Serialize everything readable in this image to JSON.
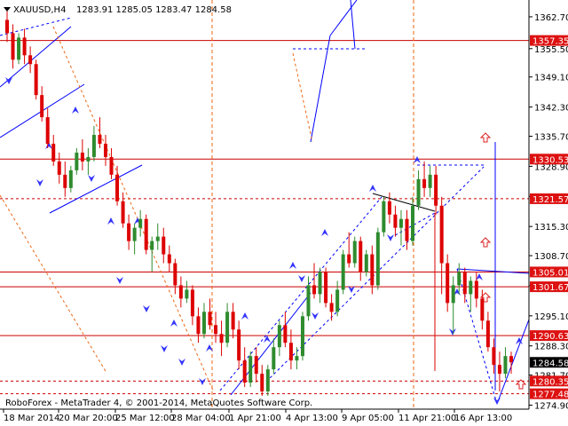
{
  "header": {
    "symbol": "XAUUSD,H4",
    "ohlc": "1283.91 1285.05 1283.47 1284.58"
  },
  "footer": {
    "copyright": "RoboForex - MetaTrader 4, © 2001-2014, MetaQuotes Software Corp."
  },
  "colors": {
    "bull": "#2e8b2e",
    "bear": "#dd0000",
    "level": "#cc0000",
    "trend": "#0000ff",
    "price_tag": "#dd1111",
    "current_tag": "#000000"
  },
  "axis": {
    "y_ticks": [
      "1362.70",
      "1355.50",
      "1349.10",
      "1342.30",
      "1335.70",
      "1328.90",
      "1322.10",
      "1315.30",
      "1308.70",
      "1301.90",
      "1295.10",
      "1288.30",
      "1281.70",
      "1274.90"
    ],
    "x_ticks": [
      "18 Mar 2014",
      "20 Mar 20:00",
      "25 Mar 12:00",
      "28 Mar 04:00",
      "1 Apr 21:00",
      "4 Apr 13:00",
      "9 Apr 05:00",
      "11 Apr 21:00",
      "16 Apr 13:00"
    ]
  },
  "chart_data": {
    "type": "candlestick",
    "symbol": "XAUUSD",
    "timeframe": "H4",
    "ylim": [
      1274.0,
      1366.5
    ],
    "current_price": "1284.58",
    "levels": [
      {
        "label": "1357.35",
        "value": 1357.35,
        "style": "solid"
      },
      {
        "label": "1330.53",
        "value": 1330.53,
        "style": "solid"
      },
      {
        "label": "1321.57",
        "value": 1321.57,
        "style": "dashed"
      },
      {
        "label": "1305.01",
        "value": 1305.01,
        "style": "solid"
      },
      {
        "label": "1301.67",
        "value": 1301.67,
        "style": "solid"
      },
      {
        "label": "1290.63",
        "value": 1290.63,
        "style": "solid"
      },
      {
        "label": "1280.35",
        "value": 1280.35,
        "style": "dashed"
      },
      {
        "label": "1277.48",
        "value": 1277.48,
        "style": "dashed"
      }
    ],
    "candles": [
      [
        1362.0,
        1364.0,
        1357.0,
        1359.0
      ],
      [
        1359.0,
        1361.0,
        1351.0,
        1353.0
      ],
      [
        1353.0,
        1359.0,
        1352.0,
        1358.0
      ],
      [
        1358.0,
        1360.0,
        1352.0,
        1354.0
      ],
      [
        1354.0,
        1356.0,
        1350.0,
        1352.0
      ],
      [
        1352.0,
        1353.0,
        1344.0,
        1345.0
      ],
      [
        1345.0,
        1347.0,
        1339.0,
        1340.0
      ],
      [
        1340.0,
        1342.0,
        1333.0,
        1334.0
      ],
      [
        1334.0,
        1336.0,
        1329.0,
        1330.0
      ],
      [
        1330.0,
        1332.0,
        1325.0,
        1327.0
      ],
      [
        1327.0,
        1330.0,
        1322.0,
        1324.0
      ],
      [
        1324.0,
        1329.0,
        1323.0,
        1328.0
      ],
      [
        1328.0,
        1333.0,
        1327.0,
        1332.0
      ],
      [
        1332.0,
        1335.0,
        1328.0,
        1330.0
      ],
      [
        1330.0,
        1333.0,
        1327.0,
        1331.0
      ],
      [
        1331.0,
        1338.0,
        1330.0,
        1336.0
      ],
      [
        1336.0,
        1340.0,
        1333.0,
        1334.0
      ],
      [
        1334.0,
        1336.0,
        1329.0,
        1331.0
      ],
      [
        1331.0,
        1333.0,
        1326.0,
        1327.0
      ],
      [
        1327.0,
        1329.0,
        1320.0,
        1321.0
      ],
      [
        1321.0,
        1323.0,
        1315.0,
        1316.0
      ],
      [
        1316.0,
        1318.0,
        1310.0,
        1312.0
      ],
      [
        1312.0,
        1316.0,
        1309.0,
        1315.0
      ],
      [
        1315.0,
        1319.0,
        1313.0,
        1317.0
      ],
      [
        1317.0,
        1318.0,
        1309.0,
        1310.0
      ],
      [
        1310.0,
        1313.0,
        1305.0,
        1312.0
      ],
      [
        1312.0,
        1316.0,
        1310.0,
        1313.0
      ],
      [
        1313.0,
        1315.0,
        1307.0,
        1309.0
      ],
      [
        1309.0,
        1311.0,
        1305.0,
        1307.0
      ],
      [
        1307.0,
        1308.0,
        1300.0,
        1302.0
      ],
      [
        1302.0,
        1304.0,
        1297.0,
        1299.0
      ],
      [
        1299.0,
        1303.0,
        1298.0,
        1301.0
      ],
      [
        1301.0,
        1302.0,
        1293.0,
        1295.0
      ],
      [
        1295.0,
        1297.0,
        1289.0,
        1291.0
      ],
      [
        1291.0,
        1298.0,
        1290.0,
        1296.0
      ],
      [
        1296.0,
        1299.0,
        1292.0,
        1293.0
      ],
      [
        1293.0,
        1296.0,
        1289.0,
        1291.0
      ],
      [
        1291.0,
        1294.0,
        1286.0,
        1289.0
      ],
      [
        1289.0,
        1298.0,
        1288.0,
        1296.0
      ],
      [
        1296.0,
        1298.0,
        1290.0,
        1292.0
      ],
      [
        1292.0,
        1294.0,
        1283.0,
        1285.0
      ],
      [
        1285.0,
        1288.0,
        1279.0,
        1280.0
      ],
      [
        1280.0,
        1287.0,
        1279.0,
        1286.0
      ],
      [
        1286.0,
        1288.0,
        1280.0,
        1282.0
      ],
      [
        1282.0,
        1284.0,
        1277.0,
        1278.0
      ],
      [
        1278.0,
        1284.0,
        1277.0,
        1283.0
      ],
      [
        1283.0,
        1290.0,
        1282.0,
        1288.0
      ],
      [
        1288.0,
        1294.0,
        1286.0,
        1293.0
      ],
      [
        1293.0,
        1296.0,
        1288.0,
        1289.0
      ],
      [
        1289.0,
        1292.0,
        1283.0,
        1285.0
      ],
      [
        1285.0,
        1288.0,
        1283.0,
        1286.0
      ],
      [
        1286.0,
        1296.0,
        1285.0,
        1295.0
      ],
      [
        1295.0,
        1304.0,
        1294.0,
        1302.0
      ],
      [
        1302.0,
        1307.0,
        1299.0,
        1300.0
      ],
      [
        1300.0,
        1306.0,
        1298.0,
        1305.0
      ],
      [
        1305.0,
        1306.0,
        1297.0,
        1298.0
      ],
      [
        1298.0,
        1300.0,
        1294.0,
        1296.0
      ],
      [
        1296.0,
        1303.0,
        1295.0,
        1301.0
      ],
      [
        1301.0,
        1310.0,
        1300.0,
        1309.0
      ],
      [
        1309.0,
        1314.0,
        1306.0,
        1307.0
      ],
      [
        1307.0,
        1313.0,
        1306.0,
        1312.0
      ],
      [
        1312.0,
        1313.0,
        1303.0,
        1305.0
      ],
      [
        1305.0,
        1310.0,
        1304.0,
        1309.0
      ],
      [
        1309.0,
        1311.0,
        1300.0,
        1302.0
      ],
      [
        1302.0,
        1315.0,
        1301.0,
        1314.0
      ],
      [
        1314.0,
        1322.0,
        1313.0,
        1321.0
      ],
      [
        1321.0,
        1323.0,
        1316.0,
        1318.0
      ],
      [
        1318.0,
        1320.0,
        1313.0,
        1315.0
      ],
      [
        1315.0,
        1319.0,
        1311.0,
        1317.0
      ],
      [
        1317.0,
        1319.0,
        1310.0,
        1312.0
      ],
      [
        1312.0,
        1322.0,
        1311.0,
        1320.0
      ],
      [
        1320.0,
        1328.0,
        1319.0,
        1326.0
      ],
      [
        1326.0,
        1330.0,
        1322.0,
        1324.0
      ],
      [
        1324.0,
        1329.0,
        1322.0,
        1327.0
      ],
      [
        1327.0,
        1329.0,
        1318.0,
        1320.0
      ],
      [
        1320.0,
        1322.0,
        1300.0,
        1307.0
      ],
      [
        1307.0,
        1309.0,
        1296.0,
        1298.0
      ],
      [
        1298.0,
        1304.0,
        1291.0,
        1302.0
      ],
      [
        1302.0,
        1307.0,
        1300.0,
        1305.0
      ],
      [
        1305.0,
        1306.0,
        1298.0,
        1300.0
      ],
      [
        1300.0,
        1304.0,
        1296.0,
        1303.0
      ],
      [
        1303.0,
        1305.0,
        1297.0,
        1299.0
      ],
      [
        1299.0,
        1301.0,
        1292.0,
        1294.0
      ],
      [
        1294.0,
        1296.0,
        1287.0,
        1288.0
      ],
      [
        1288.0,
        1290.0,
        1282.0,
        1284.0
      ],
      [
        1284.0,
        1287.0,
        1278.0,
        1282.0
      ],
      [
        1282.0,
        1288.0,
        1281.0,
        1286.0
      ],
      [
        1286.0,
        1287.0,
        1282.0,
        1284.58
      ]
    ]
  }
}
